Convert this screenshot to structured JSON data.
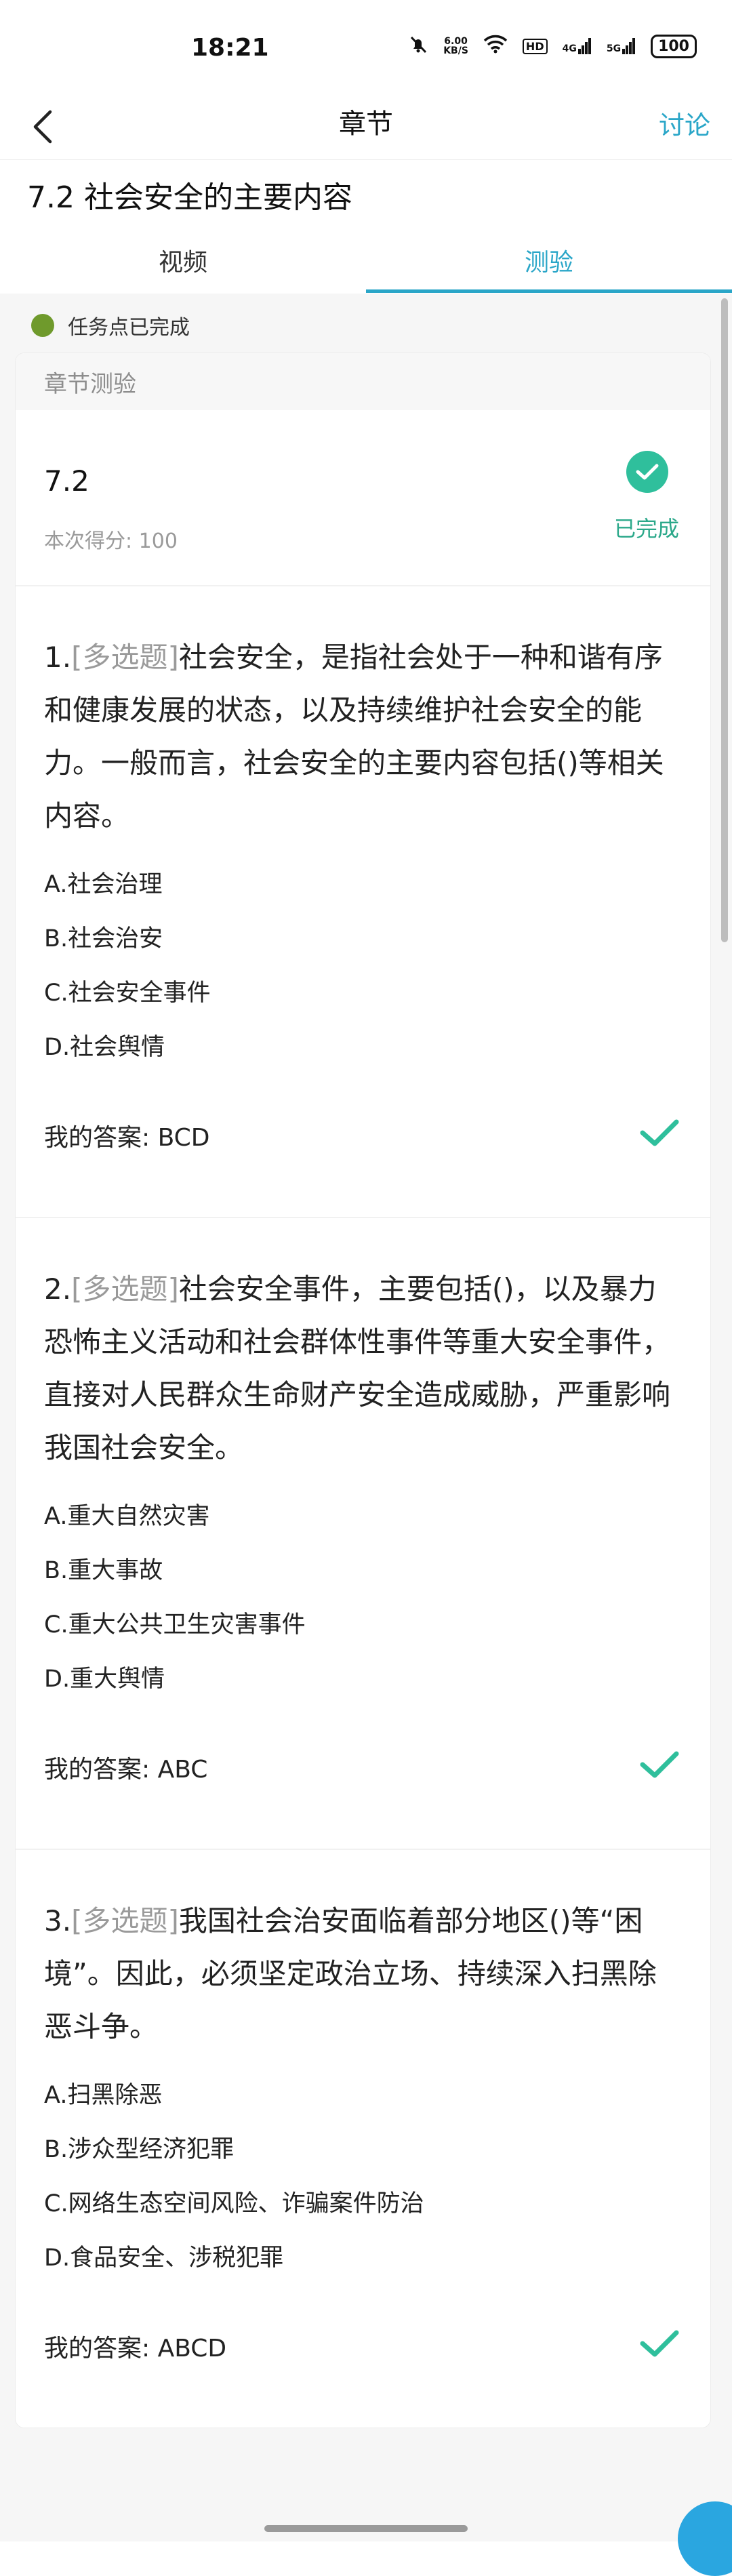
{
  "status_bar": {
    "time": "18:21",
    "net_speed_value": "6.00",
    "net_speed_unit": "KB/S",
    "hd_label": "HD",
    "signal_1": "4G",
    "signal_2": "5G",
    "battery": "100"
  },
  "nav": {
    "title": "章节",
    "discuss_label": "讨论"
  },
  "page_title": "7.2 社会安全的主要内容",
  "tabs": [
    {
      "label": "视频",
      "active": false
    },
    {
      "label": "测验",
      "active": true
    }
  ],
  "task_status": "任务点已完成",
  "card": {
    "header": "章节测验",
    "quiz_name": "7.2",
    "score_text": "本次得分: 100",
    "done_label": "已完成"
  },
  "questions": [
    {
      "number": "1.",
      "type": "[多选题]",
      "text": "社会安全，是指社会处于一种和谐有序和健康发展的状态，以及持续维护社会安全的能力。一般而言，社会安全的主要内容包括()等相关内容。",
      "options": [
        "A.社会治理",
        "B.社会治安",
        "C.社会安全事件",
        "D.社会舆情"
      ],
      "answer_text": "我的答案: BCD"
    },
    {
      "number": "2.",
      "type": "[多选题]",
      "text": "社会安全事件，主要包括()，以及暴力恐怖主义活动和社会群体性事件等重大安全事件，直接对人民群众生命财产安全造成威胁，严重影响我国社会安全。",
      "options": [
        "A.重大自然灾害",
        "B.重大事故",
        "C.重大公共卫生灾害事件",
        "D.重大舆情"
      ],
      "answer_text": "我的答案: ABC"
    },
    {
      "number": "3.",
      "type": "[多选题]",
      "text": "我国社会治安面临着部分地区()等“困境”。因此，必须坚定政治立场、持续深入扫黑除恶斗争。",
      "options": [
        "A.扫黑除恶",
        "B.涉众型经济犯罪",
        "C.网络生态空间风险、诈骗案件防治",
        "D.食品安全、涉税犯罪"
      ],
      "answer_text": "我的答案: ABCD"
    }
  ],
  "colors": {
    "accent": "#2aa6c8",
    "success": "#2fbf9c",
    "task_dot": "#6f9a2c"
  }
}
